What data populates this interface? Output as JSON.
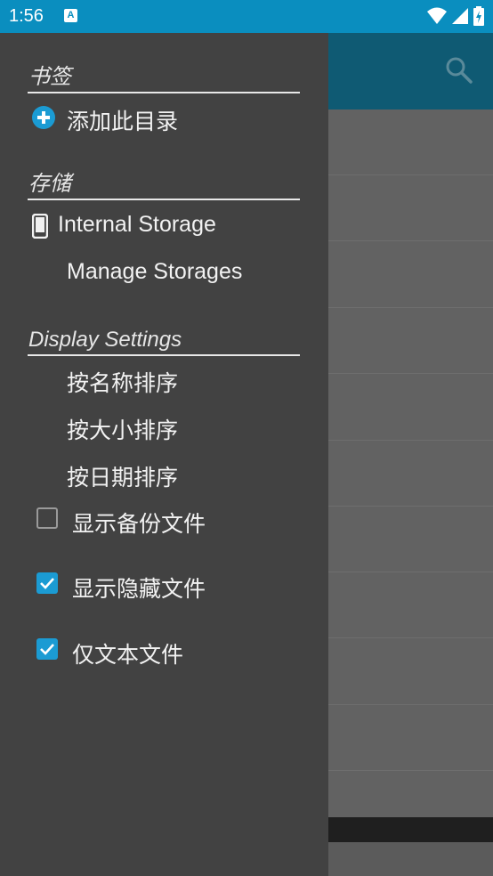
{
  "status_bar": {
    "time": "1:56",
    "notification_icon": "A",
    "icons": [
      "wifi-icon",
      "signal-icon",
      "battery-charging-icon"
    ],
    "background_color": "#0a8ebf"
  },
  "app": {
    "toolbar_color": "#0f5a73",
    "action_icon": "search-icon"
  },
  "drawer": {
    "bookmarks": {
      "header": "书签",
      "add_item": {
        "label": "添加此目录",
        "icon": "add-circle-icon"
      }
    },
    "storage": {
      "header": "存储",
      "internal": {
        "label": "Internal Storage",
        "icon": "phone-icon"
      },
      "manage": {
        "label": "Manage Storages"
      }
    },
    "display_settings": {
      "header": "Display Settings",
      "sort_by_name": "按名称排序",
      "sort_by_size": "按大小排序",
      "sort_by_date": "按日期排序",
      "show_backup": {
        "label": "显示备份文件",
        "checked": false
      },
      "show_hidden": {
        "label": "显示隐藏文件",
        "checked": true
      },
      "text_only": {
        "label": "仅文本文件",
        "checked": true
      }
    },
    "accent_color": "#1b9bd3"
  }
}
